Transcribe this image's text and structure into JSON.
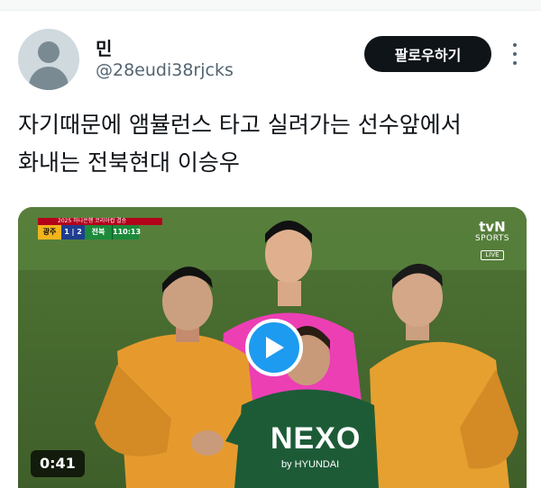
{
  "author": {
    "name": "민",
    "handle": "@28eudi38rjcks"
  },
  "actions": {
    "follow_label": "팔로우하기",
    "more_icon": "more-vertical-icon"
  },
  "tweet": {
    "text_line1": "자기때문에 앰뷸런스 타고 실려가는 선수앞에서",
    "text_line2": "화내는 전북현대 이승우"
  },
  "media": {
    "duration": "0:41",
    "play_icon": "play-icon",
    "scoreboard": {
      "header": "2025 하나은행 코리아컵 결승",
      "team1": "광주",
      "score": "1 | 2",
      "team2": "전북",
      "time": "110:13"
    },
    "broadcaster": {
      "name": "tvN",
      "sub": "SPORTS",
      "badge": "LIVE"
    },
    "jersey_sponsor": "NEXO",
    "jersey_sub": "by HYUNDAI"
  },
  "colors": {
    "follow_bg": "#0f1419",
    "play_accent": "#1d9bf0",
    "handle_gray": "#536471"
  }
}
